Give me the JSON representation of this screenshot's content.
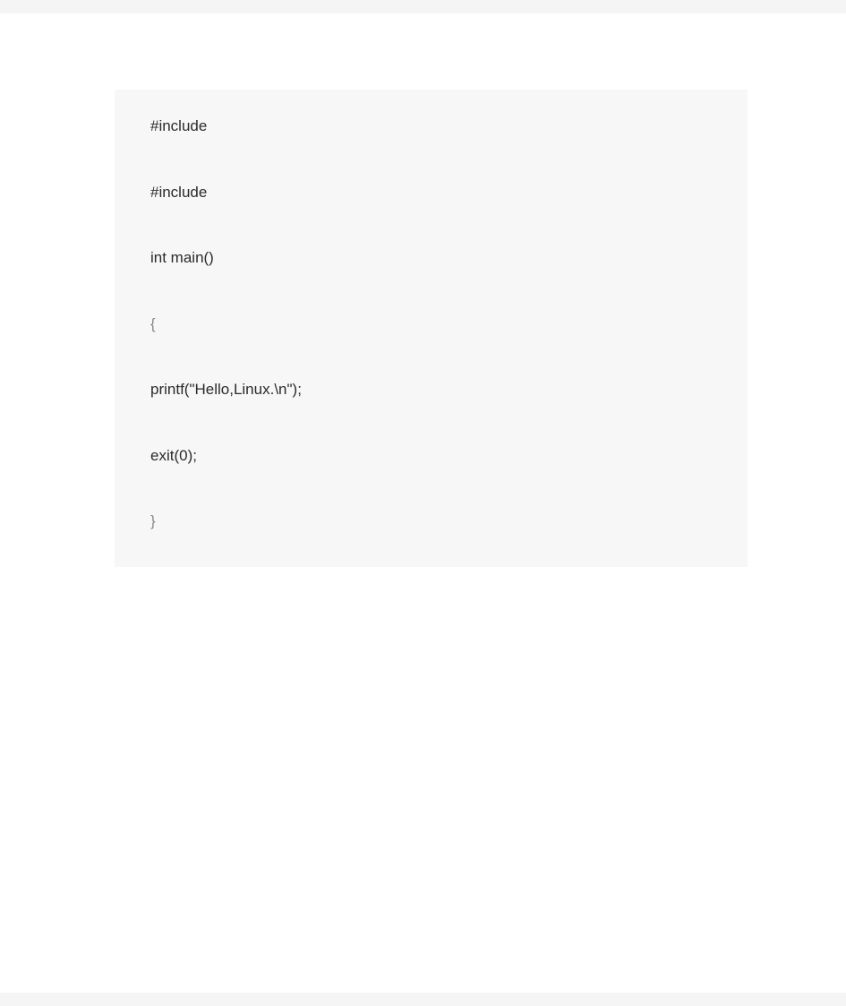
{
  "code": {
    "lines": [
      "#include",
      "#include",
      "int  main()",
      "{",
      "printf(\"Hello,Linux.\\n\");",
      "exit(0);",
      "}"
    ]
  }
}
